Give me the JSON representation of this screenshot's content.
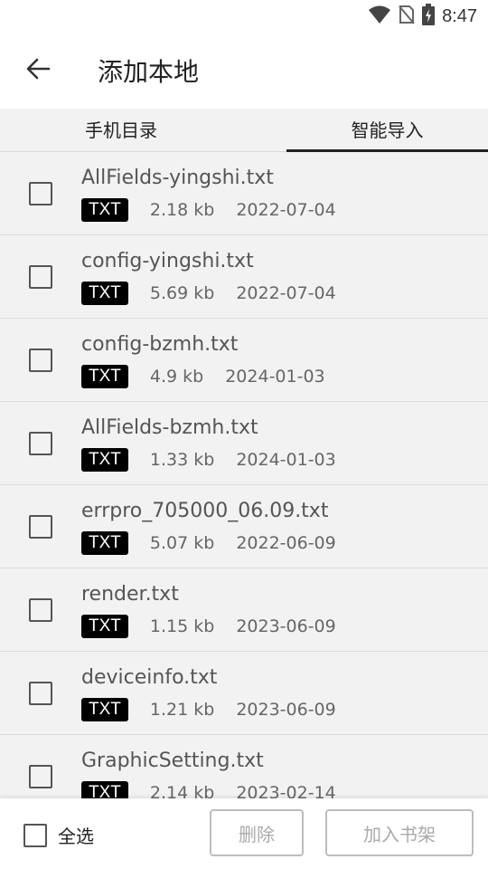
{
  "status_bar": {
    "time": "8:47",
    "icons": [
      "wifi-icon",
      "no-sim-icon",
      "battery-charging-icon"
    ]
  },
  "app_bar": {
    "back_icon": "arrow-left-icon",
    "title": "添加本地"
  },
  "tabs": [
    {
      "label": "手机目录",
      "active": false
    },
    {
      "label": "智能导入",
      "active": true
    }
  ],
  "files": [
    {
      "name": "AllFields-yingshi.txt",
      "type": "TXT",
      "size": "2.18 kb",
      "date": "2022-07-04"
    },
    {
      "name": "config-yingshi.txt",
      "type": "TXT",
      "size": "5.69 kb",
      "date": "2022-07-04"
    },
    {
      "name": "config-bzmh.txt",
      "type": "TXT",
      "size": "4.9 kb",
      "date": "2024-01-03"
    },
    {
      "name": "AllFields-bzmh.txt",
      "type": "TXT",
      "size": "1.33 kb",
      "date": "2024-01-03"
    },
    {
      "name": "errpro_705000_06.09.txt",
      "type": "TXT",
      "size": "5.07 kb",
      "date": "2022-06-09"
    },
    {
      "name": "render.txt",
      "type": "TXT",
      "size": "1.15 kb",
      "date": "2023-06-09"
    },
    {
      "name": "deviceinfo.txt",
      "type": "TXT",
      "size": "1.21 kb",
      "date": "2023-06-09"
    },
    {
      "name": "GraphicSetting.txt",
      "type": "TXT",
      "size": "2.14 kb",
      "date": "2023-02-14"
    }
  ],
  "bottom": {
    "select_all_label": "全选",
    "delete_label": "删除",
    "add_label": "加入书架"
  },
  "colors": {
    "tag_bg": "#000000",
    "list_bg": "#f2f2f2",
    "disabled_text": "#aaaaaa"
  }
}
